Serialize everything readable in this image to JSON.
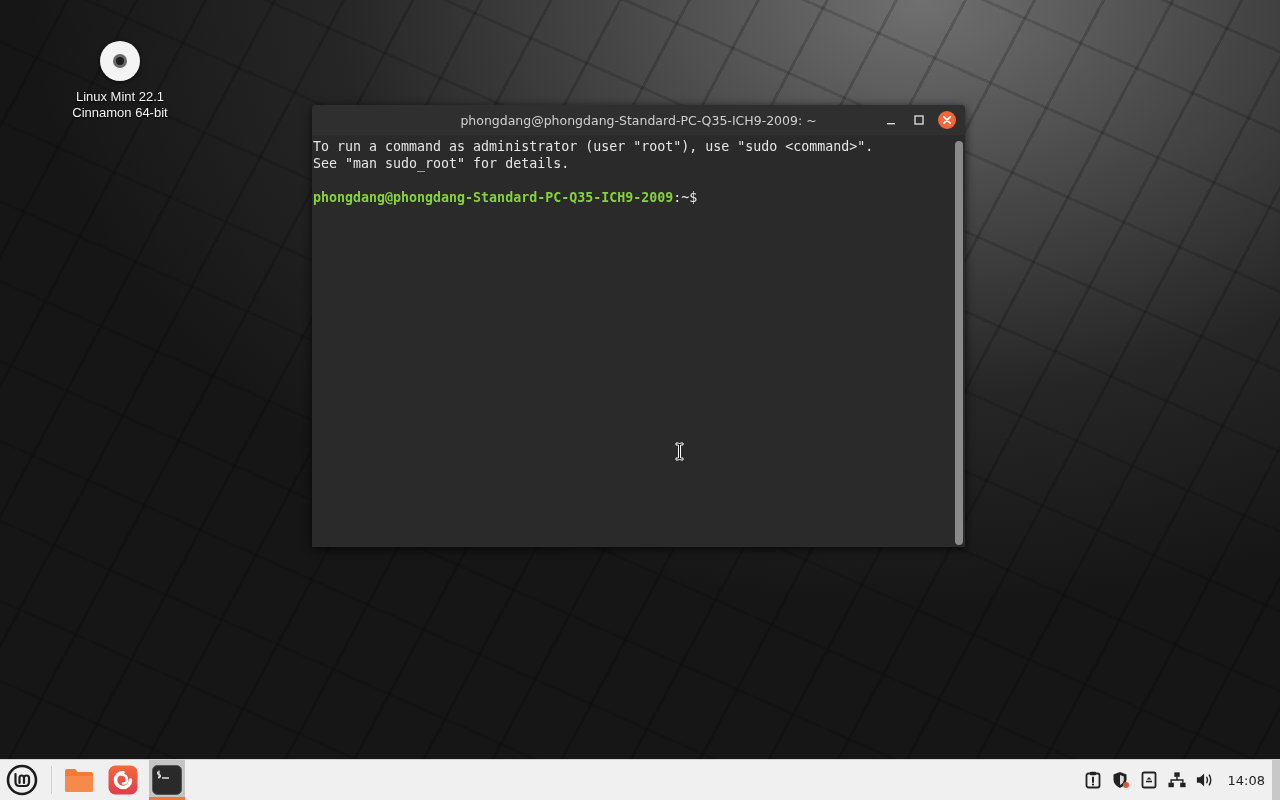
{
  "desktop_icons": [
    {
      "label": "Linux Mint 22.1 Cinnamon 64-bit"
    }
  ],
  "terminal_window": {
    "title": "phongdang@phongdang-Standard-PC-Q35-ICH9-2009: ~",
    "output_lines": [
      "To run a command as administrator (user \"root\"), use \"sudo <command>\".",
      "See \"man sudo_root\" for details."
    ],
    "prompt": {
      "user_host": "phongdang@phongdang-Standard-PC-Q35-ICH9-2009",
      "suffix": ":~$"
    }
  },
  "taskbar": {
    "launchers": [
      {
        "kind": "files",
        "active": false
      },
      {
        "kind": "web",
        "active": false
      },
      {
        "kind": "terminal",
        "active": true
      }
    ],
    "clock": "14:08"
  }
}
